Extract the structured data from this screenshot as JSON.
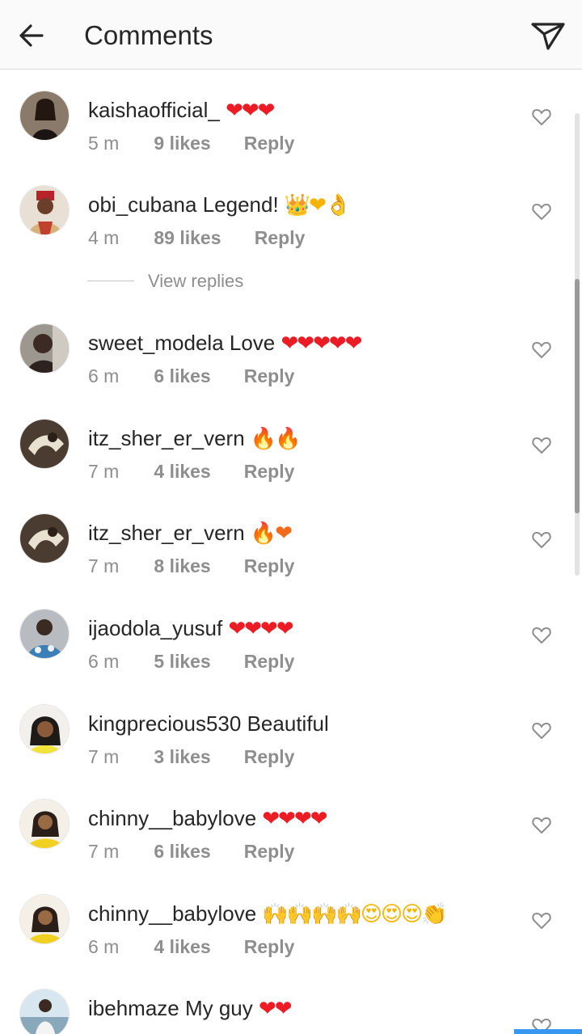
{
  "header": {
    "title": "Comments",
    "back_icon": "arrow-left-icon",
    "share_icon": "paper-plane-icon"
  },
  "view_replies": "View replies",
  "comments": [
    {
      "username": "kaishaofficial_",
      "text": "",
      "emoji": "❤❤❤",
      "emoji_type": "heart",
      "time": "5 m",
      "likes": "9 likes",
      "reply": "Reply"
    },
    {
      "username": "obi_cubana",
      "text": "Legend!",
      "emoji": "👑❤👌",
      "emoji_type": "gold",
      "time": "4 m",
      "likes": "89 likes",
      "reply": "Reply"
    },
    {
      "username": "sweet_modela",
      "text": "Love",
      "emoji": "❤❤❤❤❤",
      "emoji_type": "heart",
      "time": "6 m",
      "likes": "6 likes",
      "reply": "Reply"
    },
    {
      "username": "itz_sher_er_vern",
      "text": "",
      "emoji": "🔥🔥",
      "emoji_type": "fire",
      "time": "7 m",
      "likes": "4 likes",
      "reply": "Reply"
    },
    {
      "username": "itz_sher_er_vern",
      "text": "",
      "emoji": "🔥❤",
      "emoji_type": "fire",
      "time": "7 m",
      "likes": "8 likes",
      "reply": "Reply"
    },
    {
      "username": "ijaodola_yusuf",
      "text": "",
      "emoji": "❤❤❤❤",
      "emoji_type": "heart",
      "time": "6 m",
      "likes": "5 likes",
      "reply": "Reply"
    },
    {
      "username": "kingprecious530",
      "text": "Beautiful",
      "emoji": "",
      "emoji_type": "heart",
      "time": "7 m",
      "likes": "3 likes",
      "reply": "Reply"
    },
    {
      "username": "chinny__babylove",
      "text": "",
      "emoji": "❤❤❤❤",
      "emoji_type": "heart",
      "time": "7 m",
      "likes": "6 likes",
      "reply": "Reply"
    },
    {
      "username": "chinny__babylove",
      "text": "",
      "emoji": "🙌🙌🙌🙌😍😍😍👏",
      "emoji_type": "gold",
      "time": "6 m",
      "likes": "4 likes",
      "reply": "Reply"
    },
    {
      "username": "ibehmaze",
      "text": "My guy",
      "emoji": "❤❤",
      "emoji_type": "heart",
      "time": "",
      "likes": "",
      "reply": ""
    }
  ],
  "colors": {
    "username": "#262626",
    "meta": "#8e8e8e",
    "heart": "#ed1c24",
    "header_bg": "#fafafa",
    "accent": "#3897f0"
  }
}
